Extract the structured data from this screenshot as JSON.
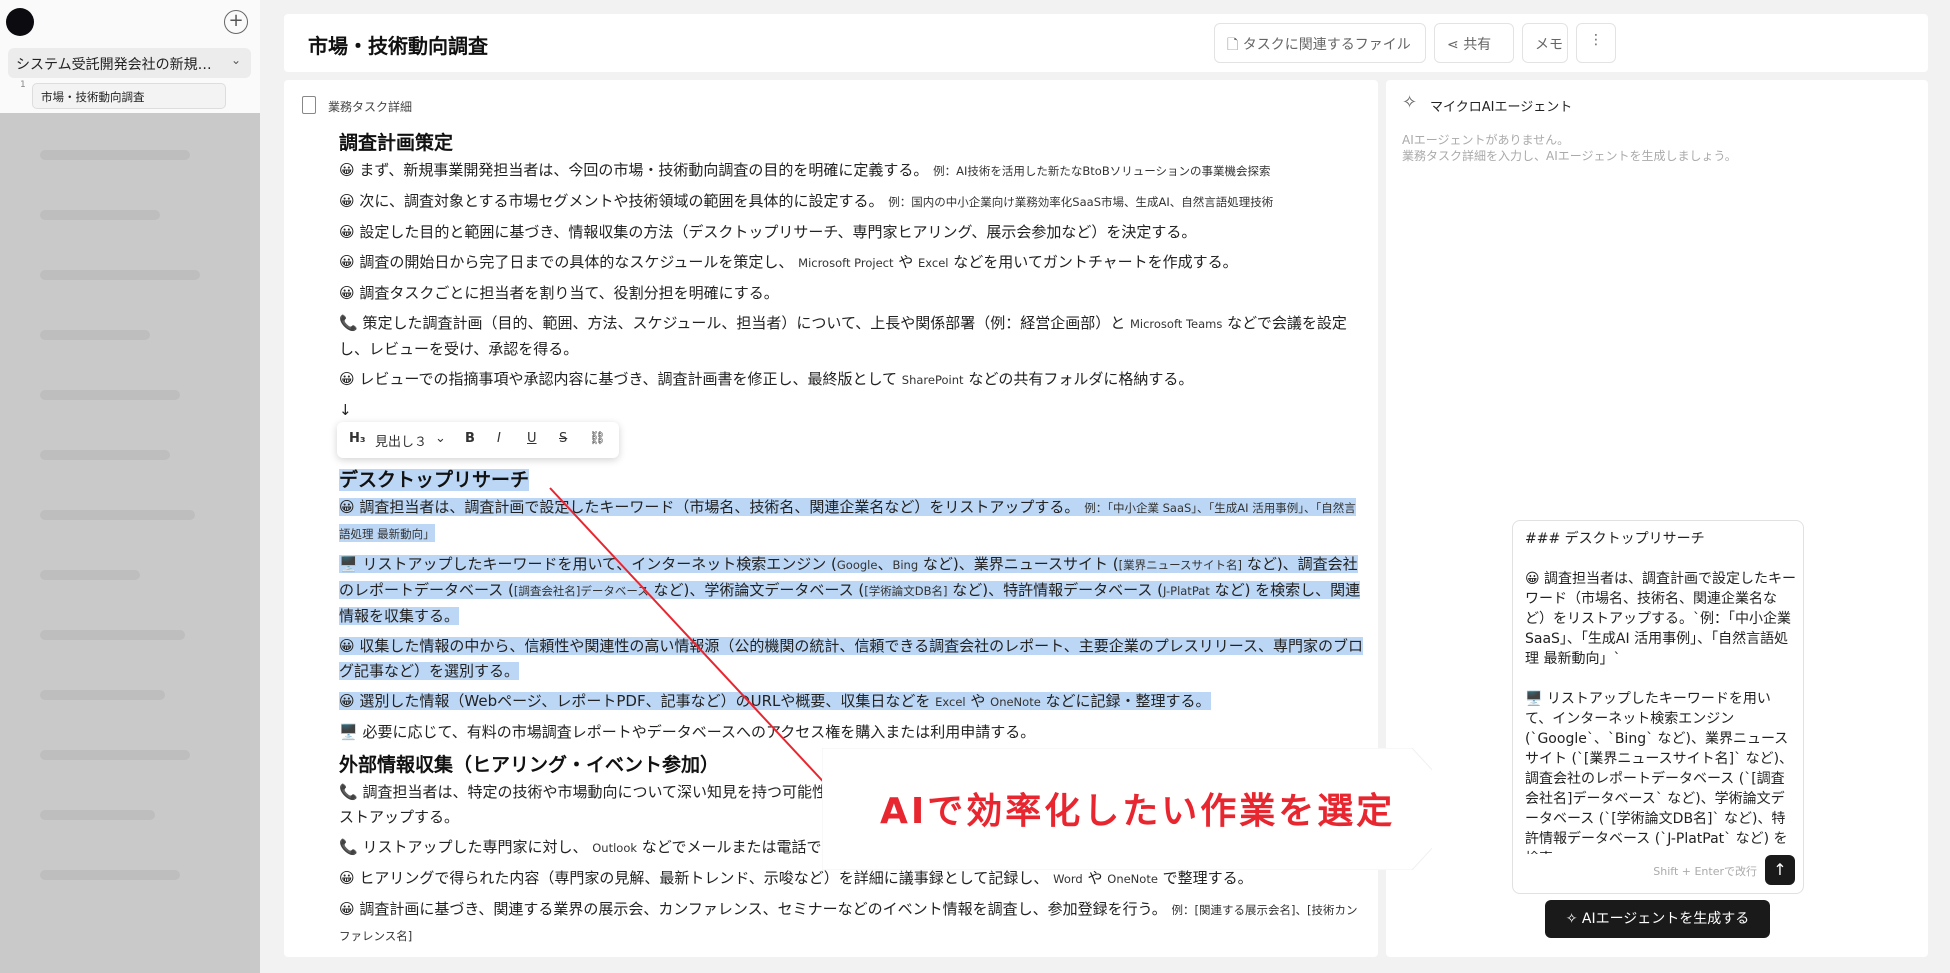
{
  "sidebar": {
    "project_label": "システム受託開発会社の新規…",
    "task_number": "1",
    "task_label": "市場・技術動向調査"
  },
  "header": {
    "title": "市場・技術動向調査",
    "files_button": "タスクに関連するファイル",
    "share_button": "共有",
    "memo_button": "メモ"
  },
  "main": {
    "label": "業務タスク詳細",
    "toolbar": {
      "heading_select": "見出し３",
      "bold": "B",
      "italic": "I",
      "underline": "U",
      "strike": "S"
    },
    "arrow_line": "↓",
    "sections": [
      {
        "heading": "調査計画策定",
        "lines": [
          [
            "😀 まず、新規事業開発担当者は、今回の市場・技術動向調査の目的を明確に定義する。",
            "例：AI技術を活用した新たなBtoBソリューションの事業機会探索",
            ""
          ],
          [
            "😀 次に、調査対象とする市場セグメントや技術領域の範囲を具体的に設定する。",
            "例：国内の中小企業向け業務効率化SaaS市場、生成AI、自然言語処理技術",
            ""
          ],
          [
            "😀 設定した目的と範囲に基づき、情報収集の方法（デスクトップリサーチ、専門家ヒアリング、展示会参加など）を決定する。",
            "",
            ""
          ],
          [
            "😀 調査の開始日から完了日までの具体的なスケジュールを策定し、",
            "Microsoft Project",
            " や ",
            "Excel",
            " などを用いてガントチャートを作成する。"
          ],
          [
            "😀 調査タスクごとに担当者を割り当て、役割分担を明確にする。",
            "",
            ""
          ],
          [
            "📞 策定した調査計画（目的、範囲、方法、スケジュール、担当者）について、上長や関係部署（例：経営企画部）と",
            "Microsoft Teams",
            " などで会議を設定し、レビューを受け、承認を得る。"
          ],
          [
            "😀 レビューでの指摘事項や承認内容に基づき、調査計画書を修正し、最終版として",
            "SharePoint",
            " などの共有フォルダに格納する。"
          ]
        ]
      },
      {
        "heading": "デスクトップリサーチ",
        "lines": [
          [
            "😀 調査担当者は、調査計画で設定したキーワード（市場名、技術名、関連企業名など）をリストアップする。",
            "例：「中小企業 SaaS」、「生成AI 活用事例」、「自然言語処理 最新動向」",
            ""
          ],
          [
            "🖥️ リストアップしたキーワードを用いて、インターネット検索エンジン (",
            "Google",
            "、",
            "Bing",
            " など)、業界ニュースサイト (",
            "[業界ニュースサイト名]",
            " など)、調査会社のレポートデータベース (",
            "[調査会社名]データベース",
            " など)、学術論文データベース (",
            "[学術論文DB名]",
            " など)、特許情報データベース (",
            "J-PlatPat",
            " など) を検索し、関連情報を収集する。"
          ],
          [
            "😀 収集した情報の中から、信頼性や関連性の高い情報源（公的機関の統計、信頼できる調査会社のレポート、主要企業のプレスリリース、専門家のブログ記事など）を選別する。"
          ],
          [
            "😀 選別した情報（Webページ、レポートPDF、記事など）のURLや概要、収集日などを",
            "Excel",
            " や ",
            "OneNote",
            " などに記録・整理する。"
          ],
          [
            "🖥️ 必要に応じて、有料の市場調査レポートやデータベースへのアクセス権を購入または利用申請する。"
          ]
        ]
      },
      {
        "heading": "外部情報収集（ヒアリング・イベント参加）",
        "lines": [
          [
            "📞 調査担当者は、特定の技術や市場動向について深い知見を持つ可能性のある専門家（大学教授、業界コンサルタント、企業の技術担当者など）をリストアップする。"
          ],
          [
            "📞 リストアップした専門家に対し、",
            "Outlook",
            " などでメールまたは電話でヒアリングを依頼する。"
          ],
          [
            "😀 ヒアリングで得られた内容（専門家の見解、最新トレンド、示唆など）を詳細に議事録として記録し、",
            "Word",
            " や ",
            "OneNote",
            " で整理する。"
          ],
          [
            "😀 調査計画に基づき、関連する業界の展示会、カンファレンス、セミナーなどのイベント情報を調査し、参加登録を行う。",
            "例：[関連する展示会名]、[技術カンファレンス名]"
          ]
        ]
      }
    ]
  },
  "right": {
    "title": "マイクロAIエージェント",
    "empty_line1": "AIエージェントがありません。",
    "empty_line2": "業務タスク詳細を入力し、AIエージェントを生成しましょう。",
    "input_text": "### デスクトップリサーチ\n\n😀 調査担当者は、調査計画で設定したキーワード（市場名、技術名、関連企業名など）をリストアップする。`例：「中小企業 SaaS」、「生成AI 活用事例」、「自然言語処理 最新動向」`\n\n🖥️ リストアップしたキーワードを用いて、インターネット検索エンジン (`Google`、`Bing` など)、業界ニュースサイト (`[業界ニュースサイト名]` など)、調査会社のレポートデータベース (`[調査会社名]データベース` など)、学術論文データベース (`[学術論文DB名]` など)、特許情報データベース (`J-PlatPat` など) を検索",
    "hint": "Shift + Enterで改行",
    "generate_button": "AIエージェントを生成する"
  },
  "callout": {
    "text": "AIで効率化したい作業を選定",
    "color": "#e8262f"
  }
}
